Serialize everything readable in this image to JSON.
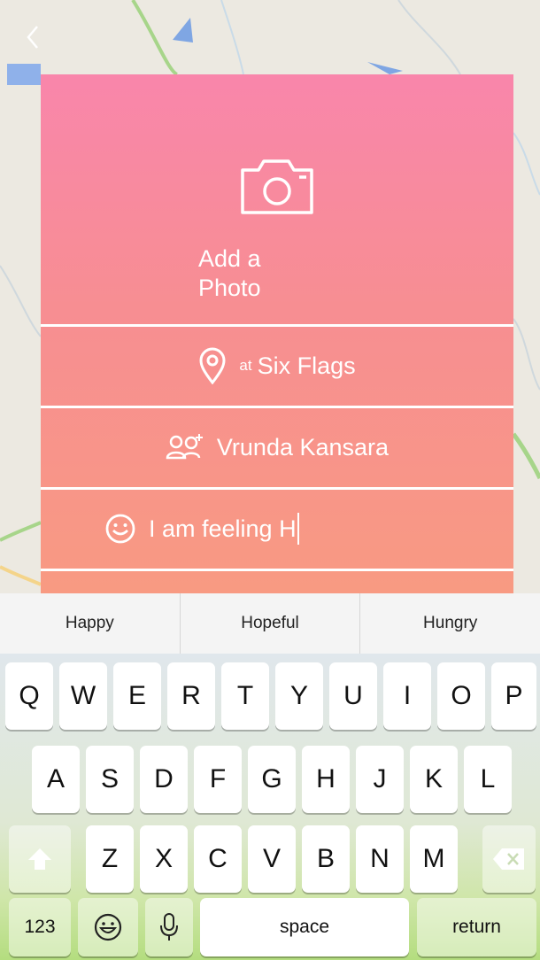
{
  "card": {
    "add_photo_line1": "Add a",
    "add_photo_line2": "Photo",
    "location_prefix": "at",
    "location_name": "Six Flags",
    "tagged_person": "Vrunda Kansara",
    "feeling_text": "I am feeling H"
  },
  "suggestions": [
    "Happy",
    "Hopeful",
    "Hungry"
  ],
  "keyboard": {
    "row1": [
      "Q",
      "W",
      "E",
      "R",
      "T",
      "Y",
      "U",
      "I",
      "O",
      "P"
    ],
    "row2": [
      "A",
      "S",
      "D",
      "F",
      "G",
      "H",
      "J",
      "K",
      "L"
    ],
    "row3": [
      "Z",
      "X",
      "C",
      "V",
      "B",
      "N",
      "M"
    ],
    "numbers_label": "123",
    "space_label": "space",
    "return_label": "return"
  },
  "icons": {
    "back": "chevron-left-icon",
    "camera": "camera-icon",
    "location": "location-pin-icon",
    "tag_people": "tag-people-icon",
    "feeling": "smiley-icon",
    "shift": "shift-icon",
    "delete": "backspace-icon",
    "emoji": "emoji-icon",
    "mic": "microphone-icon"
  },
  "colors": {
    "card_top": "#f986ab",
    "card_bottom": "#f89a82",
    "keyboard_bottom": "#b4dd7f"
  }
}
